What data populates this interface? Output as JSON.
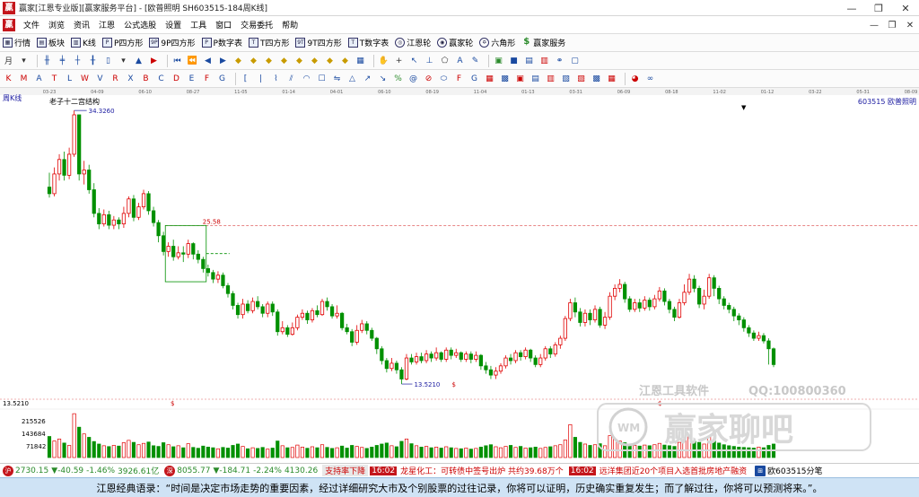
{
  "window": {
    "icon": "贏",
    "title": "赢家[江恩专业版][赢家服务平台] - [欧普照明  SH603515-184周K线]",
    "controls": [
      "—",
      "❐",
      "✕"
    ]
  },
  "menu": {
    "icon": "贏",
    "items": [
      "文件",
      "浏览",
      "资讯",
      "江恩",
      "公式选股",
      "设置",
      "工具",
      "窗口",
      "交易委托",
      "帮助"
    ],
    "mdi_controls": [
      "—",
      "❐",
      "✕"
    ]
  },
  "toolbar": {
    "items": [
      {
        "label": "行情",
        "icon": "grid-icon",
        "glyph": "▦"
      },
      {
        "label": "板块",
        "icon": "blocks-icon",
        "glyph": "▤"
      },
      {
        "label": "K线",
        "icon": "kline-icon",
        "glyph": "▥"
      },
      {
        "label": "P四方形",
        "icon": "square-p-icon",
        "glyph": "P"
      },
      {
        "label": "9P四方形",
        "icon": "square-9p-icon",
        "glyph": "9P"
      },
      {
        "label": "P数字表",
        "icon": "table-p-icon",
        "glyph": "P"
      },
      {
        "label": "T四方形",
        "icon": "square-t-icon",
        "glyph": "T"
      },
      {
        "label": "9T四方形",
        "icon": "square-9t-icon",
        "glyph": "9T"
      },
      {
        "label": "T数字表",
        "icon": "table-t-icon",
        "glyph": "T"
      },
      {
        "label": "江恩轮",
        "icon": "gann-wheel-icon",
        "glyph": "◎"
      },
      {
        "label": "赢家轮",
        "icon": "winner-wheel-icon",
        "glyph": "◉"
      },
      {
        "label": "六角形",
        "icon": "hexagon-icon",
        "glyph": "✡"
      },
      {
        "label": "赢家服务",
        "icon": "dollar-icon",
        "glyph": "$"
      }
    ]
  },
  "chart": {
    "period_label": "周K线",
    "indicator_label": "老子十二宫结构",
    "stock_label": "603515  欧普照明",
    "dropdown_glyph": "▼",
    "box_label": "25.58",
    "high_label": "34.3260",
    "low_label": "13.5210",
    "left_axis_label": "13.5210",
    "dollar_marks": [
      "$",
      "$",
      "$"
    ],
    "volume_ticks": [
      "215526",
      "143684",
      "71842"
    ],
    "watermark_brand": "江恩工具软件",
    "watermark_qq": "QQ:100800360",
    "watermark_logo": "赢家聊吧",
    "watermark_logo_glyph": "WM",
    "colors": {
      "up": "#e00000",
      "down": "#009000",
      "box": "#009000",
      "dashed_red": "#e06060",
      "annot": "#1a1aa0"
    }
  },
  "chart_data": {
    "type": "candlestick",
    "x_ticks": [
      "03-23",
      "04-09",
      "06-10",
      "08-27",
      "11-05",
      "01-14",
      "04-01",
      "06-10",
      "08-19",
      "11-04",
      "01-13",
      "03-31",
      "06-09",
      "08-18",
      "11-02",
      "01-12",
      "03-22",
      "05-31",
      "08-09"
    ],
    "y_range": [
      12.5,
      35.5
    ],
    "volume_range": [
      0,
      287368
    ],
    "candles": [
      [
        28.5,
        28.0,
        29.6,
        27.7
      ],
      [
        28.0,
        29.5,
        30.0,
        27.8
      ],
      [
        29.5,
        30.6,
        31.0,
        29.0
      ],
      [
        30.6,
        29.4,
        31.2,
        29.0
      ],
      [
        29.4,
        31.0,
        31.5,
        29.1
      ],
      [
        31.0,
        34.0,
        34.33,
        30.8
      ],
      [
        34.0,
        29.5,
        32.5,
        29.0
      ],
      [
        29.5,
        29.8,
        30.5,
        28.7
      ],
      [
        29.8,
        28.3,
        30.2,
        28.0
      ],
      [
        28.3,
        26.5,
        28.8,
        26.2
      ],
      [
        26.5,
        25.7,
        26.9,
        25.3
      ],
      [
        25.7,
        26.4,
        26.8,
        25.5
      ],
      [
        26.4,
        25.6,
        26.7,
        25.3
      ],
      [
        25.6,
        26.0,
        26.3,
        25.3
      ],
      [
        26.0,
        25.7,
        26.2,
        25.3
      ],
      [
        25.7,
        26.5,
        27.0,
        25.4
      ],
      [
        26.5,
        27.6,
        27.8,
        26.2
      ],
      [
        27.6,
        26.2,
        27.9,
        25.9
      ],
      [
        26.2,
        27.0,
        27.3,
        26.0
      ],
      [
        27.0,
        28.0,
        28.3,
        26.8
      ],
      [
        28.0,
        26.7,
        28.2,
        26.4
      ],
      [
        26.7,
        25.8,
        27.0,
        25.5
      ],
      [
        25.8,
        24.8,
        26.0,
        24.3
      ],
      [
        24.8,
        23.6,
        25.1,
        23.3
      ],
      [
        23.6,
        24.0,
        24.3,
        23.2
      ],
      [
        24.0,
        23.2,
        24.5,
        22.9
      ],
      [
        23.2,
        23.5,
        24.0,
        23.0
      ],
      [
        23.5,
        23.4,
        24.0,
        22.8
      ],
      [
        23.4,
        24.2,
        24.5,
        23.1
      ],
      [
        24.2,
        23.4,
        24.3,
        23.0
      ],
      [
        23.4,
        23.0,
        23.7,
        22.7
      ],
      [
        23.0,
        22.3,
        23.2,
        22.0
      ],
      [
        22.3,
        22.0,
        22.6,
        21.7
      ],
      [
        22.0,
        21.5,
        22.2,
        21.2
      ],
      [
        21.5,
        21.8,
        22.1,
        21.2
      ],
      [
        21.8,
        21.0,
        22.0,
        20.8
      ],
      [
        21.0,
        20.4,
        21.2,
        20.1
      ],
      [
        20.4,
        19.5,
        20.6,
        19.2
      ],
      [
        19.5,
        18.8,
        19.7,
        18.5
      ],
      [
        18.8,
        19.6,
        20.0,
        18.5
      ],
      [
        19.6,
        19.1,
        19.9,
        18.9
      ],
      [
        19.1,
        19.8,
        20.1,
        18.9
      ],
      [
        19.8,
        19.4,
        20.2,
        19.2
      ],
      [
        19.4,
        18.9,
        19.6,
        18.6
      ],
      [
        18.9,
        19.6,
        19.8,
        18.6
      ],
      [
        19.6,
        19.0,
        19.8,
        18.7
      ],
      [
        19.0,
        17.5,
        19.2,
        17.2
      ],
      [
        17.5,
        17.8,
        18.3,
        17.3
      ],
      [
        17.8,
        17.3,
        18.0,
        17.1
      ],
      [
        17.3,
        17.8,
        18.2,
        17.2
      ],
      [
        17.8,
        18.6,
        18.8,
        17.6
      ],
      [
        18.6,
        18.9,
        19.2,
        18.4
      ],
      [
        18.9,
        18.4,
        19.1,
        18.1
      ],
      [
        18.4,
        19.1,
        19.3,
        18.2
      ],
      [
        19.1,
        18.8,
        19.5,
        18.6
      ],
      [
        18.8,
        19.8,
        20.0,
        18.7
      ],
      [
        19.8,
        19.4,
        20.1,
        19.1
      ],
      [
        19.4,
        18.7,
        19.6,
        18.5
      ],
      [
        18.7,
        18.9,
        19.5,
        18.5
      ],
      [
        18.9,
        17.8,
        19.0,
        17.6
      ],
      [
        17.8,
        17.5,
        18.1,
        17.3
      ],
      [
        17.5,
        16.7,
        17.7,
        16.4
      ],
      [
        16.7,
        17.6,
        18.0,
        16.5
      ],
      [
        17.6,
        18.1,
        18.4,
        17.4
      ],
      [
        18.1,
        17.6,
        18.3,
        17.3
      ],
      [
        17.6,
        17.0,
        17.8,
        16.8
      ],
      [
        17.0,
        16.2,
        17.1,
        15.8
      ],
      [
        16.2,
        15.3,
        16.4,
        15.0
      ],
      [
        15.3,
        14.7,
        15.5,
        14.4
      ],
      [
        14.7,
        15.1,
        15.5,
        14.5
      ],
      [
        15.1,
        14.6,
        15.3,
        14.3
      ],
      [
        14.6,
        13.9,
        14.8,
        13.52
      ],
      [
        13.9,
        15.5,
        15.8,
        13.8
      ],
      [
        15.5,
        15.2,
        15.8,
        15.0
      ],
      [
        15.2,
        15.6,
        15.9,
        15.0
      ],
      [
        15.6,
        15.3,
        15.9,
        15.1
      ],
      [
        15.3,
        15.8,
        16.1,
        15.1
      ],
      [
        15.8,
        15.5,
        16.0,
        15.2
      ],
      [
        15.5,
        15.9,
        16.3,
        15.3
      ],
      [
        15.9,
        15.4,
        16.0,
        15.2
      ],
      [
        15.4,
        16.1,
        16.3,
        15.2
      ],
      [
        16.1,
        15.7,
        16.3,
        15.4
      ],
      [
        15.7,
        15.9,
        16.2,
        15.5
      ],
      [
        15.9,
        15.4,
        16.0,
        15.2
      ],
      [
        15.4,
        15.8,
        16.0,
        15.2
      ],
      [
        15.8,
        15.4,
        16.0,
        15.1
      ],
      [
        15.4,
        15.7,
        16.0,
        15.2
      ],
      [
        15.7,
        14.9,
        15.8,
        14.6
      ],
      [
        14.9,
        14.6,
        15.2,
        14.3
      ],
      [
        14.6,
        14.2,
        14.9,
        13.9
      ],
      [
        14.2,
        14.5,
        14.8,
        13.9
      ],
      [
        14.5,
        14.9,
        15.1,
        14.3
      ],
      [
        14.9,
        15.5,
        15.7,
        14.7
      ],
      [
        15.5,
        15.3,
        15.8,
        15.0
      ],
      [
        15.3,
        15.9,
        16.1,
        15.1
      ],
      [
        15.9,
        15.6,
        16.1,
        15.3
      ],
      [
        15.6,
        16.1,
        16.3,
        15.4
      ],
      [
        16.1,
        15.5,
        16.2,
        15.2
      ],
      [
        15.5,
        15.0,
        15.7,
        14.8
      ],
      [
        15.0,
        15.5,
        15.8,
        14.8
      ],
      [
        15.5,
        16.2,
        16.4,
        15.3
      ],
      [
        16.2,
        15.8,
        16.4,
        15.5
      ],
      [
        15.8,
        16.5,
        16.7,
        15.6
      ],
      [
        16.5,
        17.0,
        17.2,
        16.2
      ],
      [
        17.0,
        18.5,
        18.7,
        16.8
      ],
      [
        18.5,
        19.7,
        20.0,
        18.3
      ],
      [
        19.7,
        19.0,
        20.1,
        18.6
      ],
      [
        19.0,
        18.2,
        19.3,
        17.9
      ],
      [
        18.2,
        18.9,
        19.2,
        17.9
      ],
      [
        18.9,
        18.4,
        19.2,
        18.0
      ],
      [
        18.4,
        19.2,
        19.5,
        18.2
      ],
      [
        19.2,
        18.0,
        19.4,
        17.8
      ],
      [
        18.0,
        18.6,
        19.0,
        17.7
      ],
      [
        18.6,
        20.2,
        20.5,
        18.4
      ],
      [
        20.2,
        20.8,
        21.1,
        19.9
      ],
      [
        20.8,
        21.1,
        21.5,
        20.5
      ],
      [
        21.1,
        20.0,
        21.3,
        19.7
      ],
      [
        20.0,
        19.2,
        20.2,
        19.0
      ],
      [
        19.2,
        19.7,
        20.0,
        19.0
      ],
      [
        19.7,
        19.3,
        20.0,
        19.0
      ],
      [
        19.3,
        19.9,
        20.2,
        19.1
      ],
      [
        19.9,
        19.4,
        20.1,
        19.1
      ],
      [
        19.4,
        20.0,
        20.3,
        19.2
      ],
      [
        20.0,
        20.6,
        20.9,
        19.8
      ],
      [
        20.6,
        19.8,
        20.8,
        19.5
      ],
      [
        19.8,
        19.2,
        20.0,
        18.9
      ],
      [
        19.2,
        18.6,
        19.4,
        18.3
      ],
      [
        18.6,
        19.7,
        20.0,
        18.5
      ],
      [
        19.7,
        20.5,
        21.1,
        19.5
      ],
      [
        20.5,
        21.5,
        21.9,
        20.3
      ],
      [
        21.5,
        20.8,
        21.8,
        20.5
      ],
      [
        20.8,
        19.6,
        21.0,
        19.3
      ],
      [
        19.6,
        20.2,
        20.7,
        19.2
      ],
      [
        20.2,
        21.6,
        21.9,
        20.0
      ],
      [
        21.6,
        20.8,
        21.8,
        20.2
      ],
      [
        20.8,
        20.0,
        21.0,
        19.6
      ],
      [
        20.0,
        19.5,
        20.2,
        19.2
      ],
      [
        19.5,
        19.2,
        19.7,
        18.9
      ],
      [
        19.2,
        18.7,
        19.4,
        18.3
      ],
      [
        18.7,
        18.4,
        18.9,
        18.0
      ],
      [
        18.4,
        17.8,
        18.6,
        17.5
      ],
      [
        17.8,
        17.4,
        18.0,
        17.1
      ],
      [
        17.4,
        17.0,
        17.6,
        16.8
      ],
      [
        17.0,
        17.2,
        17.5,
        16.8
      ],
      [
        17.2,
        16.8,
        17.4,
        16.6
      ],
      [
        16.8,
        16.2,
        17.0,
        15.0
      ],
      [
        16.2,
        15.0,
        16.3,
        14.8
      ]
    ],
    "volumes": [
      125000,
      98000,
      110000,
      86000,
      72000,
      260000,
      180000,
      140000,
      120000,
      95000,
      80000,
      70000,
      65000,
      72000,
      68000,
      88000,
      102000,
      90000,
      76000,
      84000,
      92000,
      70000,
      66000,
      88000,
      76000,
      64000,
      70000,
      58000,
      82000,
      60000,
      55000,
      68000,
      62000,
      58000,
      52000,
      60000,
      56000,
      72000,
      80000,
      66000,
      52000,
      58000,
      54000,
      60000,
      50000,
      56000,
      98000,
      70000,
      58000,
      60000,
      74000,
      62000,
      55000,
      64000,
      58000,
      76000,
      60000,
      54000,
      58000,
      68000,
      56000,
      72000,
      66000,
      60000,
      54000,
      62000,
      72000,
      80000,
      86000,
      70000,
      64000,
      96000,
      110000,
      82000,
      70000,
      62000,
      66000,
      58000,
      62000,
      56000,
      64000,
      58000,
      54000,
      52000,
      56000,
      50000,
      54000,
      62000,
      70000,
      76000,
      64000,
      58000,
      66000,
      72000,
      60000,
      66000,
      56000,
      58000,
      62000,
      54000,
      60000,
      64000,
      70000,
      76000,
      104000,
      195000,
      120000,
      90000,
      80000,
      72000,
      76000,
      82000,
      70000,
      130000,
      110000,
      98000,
      88000,
      76000,
      72000,
      68000,
      74000,
      70000,
      76000,
      84000,
      74000,
      70000,
      66000,
      90000,
      106000,
      124000,
      96000,
      90000,
      80000,
      120000,
      98000,
      86000,
      76000,
      70000,
      66000,
      62000,
      60000,
      58000,
      56000,
      62000,
      58000,
      72000,
      80000
    ]
  },
  "status_bar": {
    "sh_index": "2730.15",
    "sh_change": "▼-40.59",
    "sh_pct": "-1.46%",
    "sh_amount": "3926.61亿",
    "sz_index": "8055.77",
    "sz_change": "▼-184.71",
    "sz_pct": "-2.24%",
    "sz_amount": "4130.26",
    "ticker_title": "支持率下降",
    "ticker_time1": "16:02",
    "ticker_text1": "龙星化工：可转债中签号出炉 共约39.68万个",
    "ticker_time2": "16:02",
    "ticker_text2": "远洋集团近20个项目入选首批房地产融资",
    "right_label": "欧603515分笔"
  },
  "quote": {
    "text": "江恩经典语录：“时间是决定市场走势的重要因素，经过详细研究大市及个别股票的过往记录，你将可以证明，历史确实重复发生；而了解过往，你将可以预测将来。”。"
  }
}
